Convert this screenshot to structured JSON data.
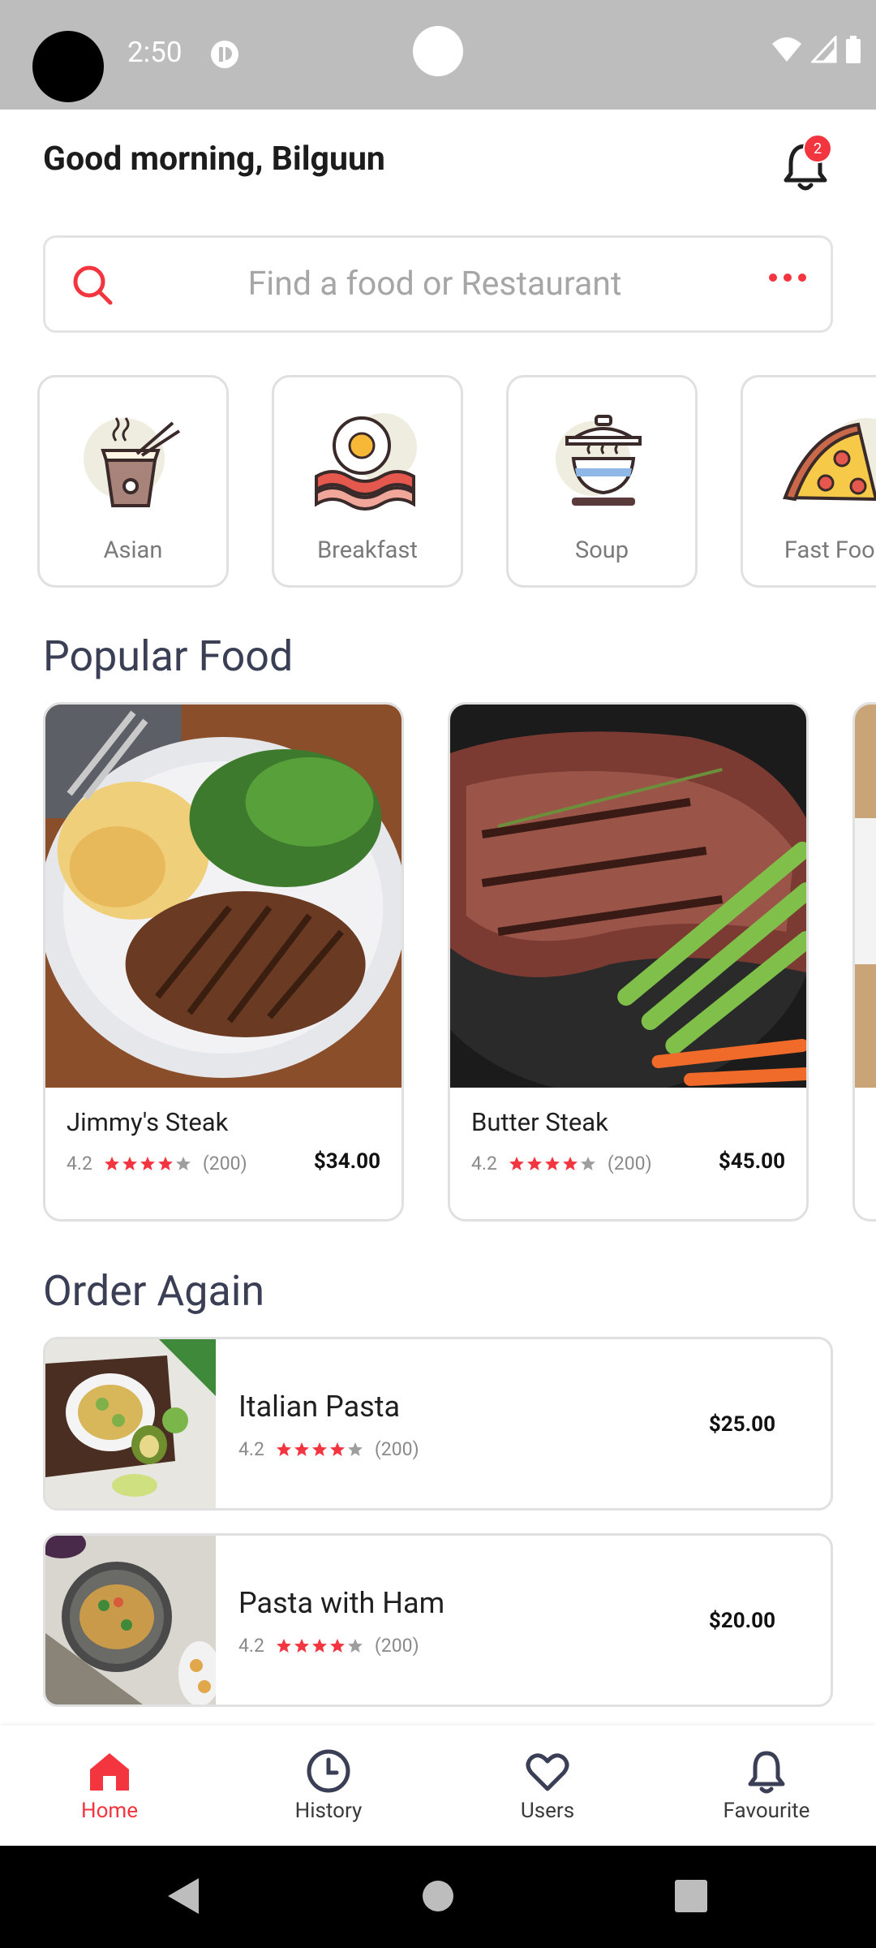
{
  "status_bar": {
    "time": "2:50"
  },
  "header": {
    "greeting": "Good morning, Bilguun",
    "notification_count": "2"
  },
  "search": {
    "placeholder": "Find a food or Restaurant"
  },
  "categories": [
    {
      "label": "Asian",
      "icon": "noodle-box-icon"
    },
    {
      "label": "Breakfast",
      "icon": "egg-bacon-icon"
    },
    {
      "label": "Soup",
      "icon": "soup-pot-icon"
    },
    {
      "label": "Fast Food",
      "icon": "pizza-icon"
    }
  ],
  "popular": {
    "title": "Popular Food",
    "items": [
      {
        "name": "Jimmy's Steak",
        "rating": "4.2",
        "rating_value": 4.2,
        "reviews": "(200)",
        "price": "$34.00"
      },
      {
        "name": "Butter Steak",
        "rating": "4.2",
        "rating_value": 4.2,
        "reviews": "(200)",
        "price": "$45.00"
      }
    ]
  },
  "order_again": {
    "title": "Order Again",
    "items": [
      {
        "name": "Italian Pasta",
        "rating": "4.2",
        "rating_value": 4.2,
        "reviews": "(200)",
        "price": "$25.00"
      },
      {
        "name": "Pasta with Ham",
        "rating": "4.2",
        "rating_value": 4.2,
        "reviews": "(200)",
        "price": "$20.00"
      }
    ]
  },
  "bottom_nav": [
    {
      "label": "Home",
      "icon": "home-icon",
      "active": true
    },
    {
      "label": "History",
      "icon": "clock-icon",
      "active": false
    },
    {
      "label": "Users",
      "icon": "heart-icon",
      "active": false
    },
    {
      "label": "Favourite",
      "icon": "bell-icon",
      "active": false
    }
  ],
  "colors": {
    "accent": "#f2353e",
    "title": "#3a3f55",
    "border": "#e0e0e0",
    "muted": "#8a8a8a"
  }
}
